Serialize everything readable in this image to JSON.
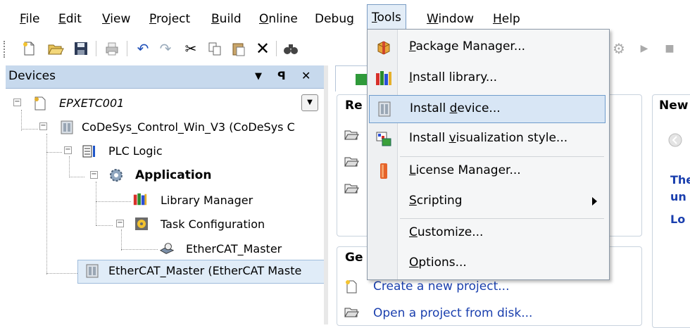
{
  "menubar": {
    "items": [
      {
        "label": "File",
        "mn": "F",
        "rest": "ile"
      },
      {
        "label": "Edit",
        "mn": "E",
        "rest": "dit"
      },
      {
        "label": "View",
        "mn": "V",
        "rest": "iew"
      },
      {
        "label": "Project",
        "mn": "P",
        "rest": "roject"
      },
      {
        "label": "Build",
        "mn": "B",
        "rest": "uild"
      },
      {
        "label": "Online",
        "mn": "O",
        "rest": "nline"
      },
      {
        "label": "Debug",
        "pre": "Debu",
        "mn": "g",
        "rest": ""
      },
      {
        "label": "Tools",
        "mn": "T",
        "rest": "ools"
      },
      {
        "label": "Window",
        "mn": "W",
        "rest": "indow"
      },
      {
        "label": "Help",
        "mn": "H",
        "rest": "elp"
      }
    ]
  },
  "devices_panel": {
    "title": "Devices",
    "tree": {
      "root": "EPXETC001",
      "controller": "CoDeSys_Control_Win_V3 (CoDeSys C",
      "plc_logic": "PLC Logic",
      "application": "Application",
      "library_manager": "Library Manager",
      "task_configuration": "Task Configuration",
      "task": "EtherCAT_Master",
      "ethercat_device": "EtherCAT_Master (EtherCAT Maste"
    }
  },
  "start_page": {
    "recent_label": "Re",
    "get_started_label": "Ge",
    "news_label": "New",
    "create_link": "Create a new project...",
    "open_link": "Open a project from disk...",
    "news_line1": "The",
    "news_line2": "un",
    "news_line3": "Lo"
  },
  "tools_menu": {
    "items": [
      {
        "pre": "",
        "mn": "P",
        "rest": "ackage Manager...",
        "label": "Package Manager...",
        "icon": "package-icon"
      },
      {
        "pre": "",
        "mn": "I",
        "rest": "nstall library...",
        "label": "Install library...",
        "icon": "library-icon"
      },
      {
        "pre": "Install ",
        "mn": "d",
        "rest": "evice...",
        "label": "Install device...",
        "icon": "device-icon"
      },
      {
        "pre": "Install ",
        "mn": "v",
        "rest": "isualization style...",
        "label": "Install visualization style...",
        "icon": "visualization-icon"
      },
      {
        "pre": "",
        "mn": "L",
        "rest": "icense Manager...",
        "label": "License Manager...",
        "icon": "license-icon"
      },
      {
        "pre": "",
        "mn": "S",
        "rest": "cripting",
        "label": "Scripting",
        "icon": ""
      },
      {
        "pre": "",
        "mn": "C",
        "rest": "ustomize...",
        "label": "Customize...",
        "icon": ""
      },
      {
        "pre": "",
        "mn": "O",
        "rest": "ptions...",
        "label": "Options...",
        "icon": ""
      }
    ]
  },
  "colors": {
    "accent": "#1a3fae",
    "panel_header": "#c7d9ed",
    "highlight": "#d8e6f5"
  }
}
